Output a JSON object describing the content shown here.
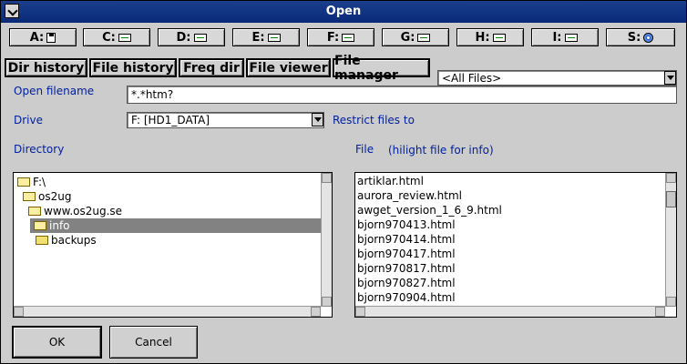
{
  "window": {
    "title": "Open"
  },
  "drives": [
    {
      "letter": "A:",
      "icon": "floppy-icon"
    },
    {
      "letter": "C:",
      "icon": "harddisk-icon"
    },
    {
      "letter": "D:",
      "icon": "harddisk-icon"
    },
    {
      "letter": "E:",
      "icon": "harddisk-icon"
    },
    {
      "letter": "F:",
      "icon": "harddisk-icon"
    },
    {
      "letter": "G:",
      "icon": "harddisk-icon"
    },
    {
      "letter": "H:",
      "icon": "harddisk-icon"
    },
    {
      "letter": "I:",
      "icon": "harddisk-icon"
    },
    {
      "letter": "S:",
      "icon": "cdrom-icon"
    }
  ],
  "tabs": {
    "dir_history": "Dir history",
    "file_history": "File history",
    "freq_dir": "Freq dir",
    "file_viewer": "File viewer",
    "file_manager": "File manager"
  },
  "filter": {
    "value": "<All Files>"
  },
  "open_filename": {
    "label": "Open filename",
    "value": "*.*htm?"
  },
  "drive": {
    "label": "Drive",
    "value": "F:  [HD1_DATA]"
  },
  "restrict": {
    "label": "Restrict files to"
  },
  "directory": {
    "label": "Directory",
    "items": [
      {
        "name": "F:\\",
        "selected": false
      },
      {
        "name": "os2ug",
        "selected": false
      },
      {
        "name": "www.os2ug.se",
        "selected": false
      },
      {
        "name": "info",
        "selected": true
      },
      {
        "name": "backups",
        "selected": false
      }
    ]
  },
  "files": {
    "label": "File",
    "hint": "(hilight file for info)",
    "items": [
      "artiklar.html",
      "aurora_review.html",
      "awget_version_1_6_9.html",
      "bjorn970413.html",
      "bjorn970414.html",
      "bjorn970417.html",
      "bjorn970817.html",
      "bjorn970827.html",
      "bjorn970904.html"
    ]
  },
  "buttons": {
    "ok": "OK",
    "cancel": "Cancel"
  }
}
